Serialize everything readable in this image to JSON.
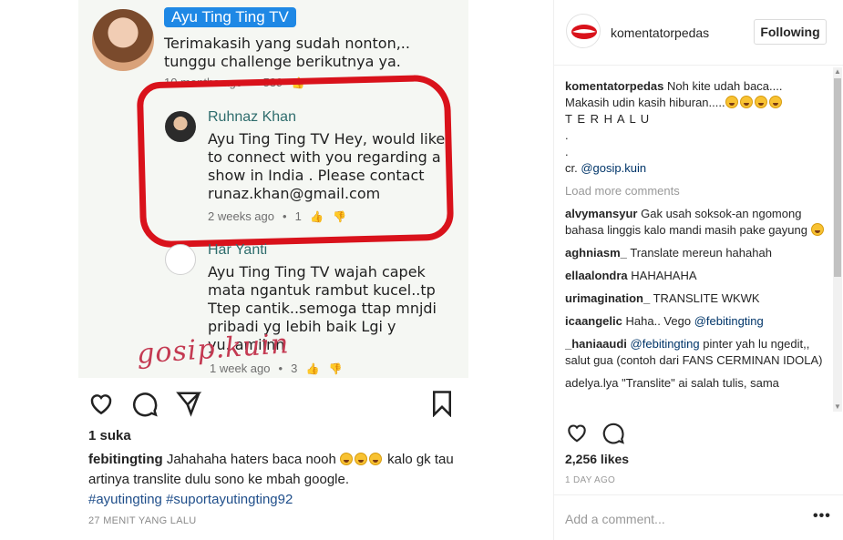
{
  "post_image": {
    "top_comment": {
      "author": "Ayu Ting Ting TV",
      "text_line1": "Terimakasih yang sudah nonton,..",
      "text_line2": "tunggu challenge berikutnya ya.",
      "time": "10 months ago",
      "likes": "539"
    },
    "reply_1": {
      "author": "Ruhnaz Khan",
      "lines": [
        "Ayu Ting Ting TV Hey, would like",
        "to connect with you regarding a",
        "show in India . Please contact",
        "runaz.khan@gmail.com"
      ],
      "time": "2 weeks ago",
      "likes": "1"
    },
    "reply_2": {
      "author": "Har Yanti",
      "lines": [
        "Ayu Ting Ting TV wajah capek",
        "mata ngantuk rambut kucel..tp",
        "Ttep cantik..semoga ttap mnjdi",
        "pribadi yg lebih baik Lgi y",
        "yu..amiinn"
      ],
      "time": "1 week ago",
      "likes": "3"
    },
    "watermark": "gosip.kuin",
    "likes_text": "1 suka",
    "caption_user": "febitingting",
    "caption_text": "Jahahaha haters baca nooh",
    "caption_text2": "kalo gk tau artinya translite dulu sono ke mbah google.",
    "caption_tags": "#ayutingting #suportayutingting92",
    "time_text": "27 MENIT YANG LALU"
  },
  "panel": {
    "username": "komentatorpedas",
    "follow_label": "Following",
    "caption": {
      "user": "komentatorpedas",
      "line1": "Noh kite udah baca....",
      "line2": "Makasih udin kasih hiburan.....",
      "line3": "T E R H A L U",
      "dot1": ".",
      "dot2": ".",
      "credit_prefix": "cr.",
      "credit_mention": "@gosip.kuin"
    },
    "load_more": "Load more comments",
    "comments": [
      {
        "user": "alvymansyur",
        "text": "Gak usah soksok-an ngomong bahasa linggis kalo mandi masih pake gayung"
      },
      {
        "user": "aghniasm_",
        "text": "Translate mereun hahahah"
      },
      {
        "user": "ellaalondra",
        "text": "HAHAHAHA"
      },
      {
        "user": "urimagination_",
        "text": "TRANSLITE WKWK"
      },
      {
        "user": "icaangelic",
        "text": "Haha.. Vego",
        "mention": "@febitingting"
      },
      {
        "user": "_haniaaudi",
        "mention": "@febitingting",
        "text": "pinter yah lu ngedit,, salut gua (contoh dari FANS CERMINAN IDOLA)"
      }
    ],
    "partial_comment": "adelya.lya \"Translite\" ai salah tulis, sama",
    "likes": "2,256 likes",
    "time": "1 DAY AGO",
    "add_comment_placeholder": "Add a comment...",
    "more_options": "•••"
  },
  "icons": [
    "heart-icon",
    "comment-icon",
    "share-icon",
    "bookmark-icon",
    "thumb-up-icon",
    "thumb-down-icon",
    "more-options-icon"
  ],
  "colors": {
    "highlight": "#d9121b",
    "youtube_blue": "#1e88e5",
    "mention": "#003569"
  }
}
